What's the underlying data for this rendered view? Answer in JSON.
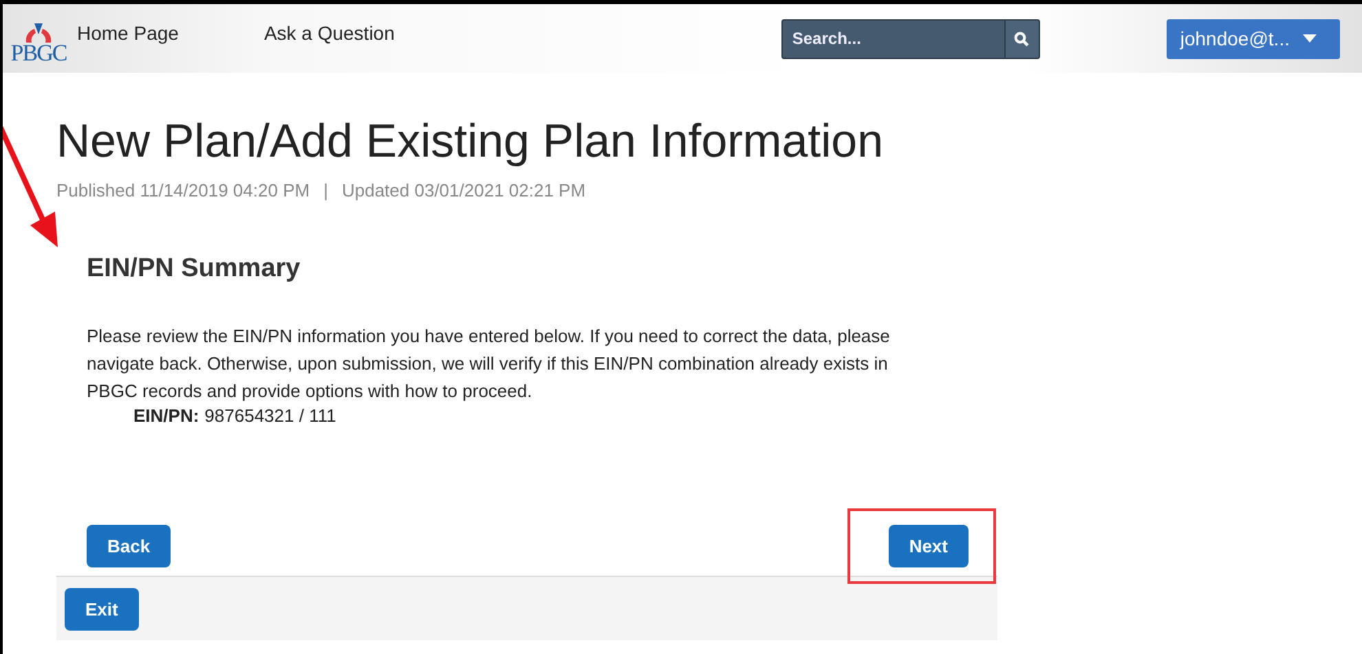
{
  "header": {
    "logo": "PBGC",
    "nav": [
      "Home Page",
      "Ask a Question"
    ],
    "search": {
      "placeholder": "Search..."
    },
    "user": "johndoe@t..."
  },
  "page": {
    "title": "New Plan/Add Existing Plan Information",
    "published": "Published 11/14/2019 04:20 PM",
    "separator": "|",
    "updated": "Updated 03/01/2021 02:21 PM"
  },
  "summary": {
    "heading": "EIN/PN Summary",
    "text": "Please review the EIN/PN information you have entered below. If you need to correct the data, please navigate back. Otherwise, upon submission, we will verify if this EIN/PN combination already exists in PBGC records and provide options with how to proceed.",
    "field_label": "EIN/PN:",
    "field_value": "987654321 / 111"
  },
  "buttons": {
    "back": "Back",
    "next": "Next",
    "exit": "Exit"
  }
}
